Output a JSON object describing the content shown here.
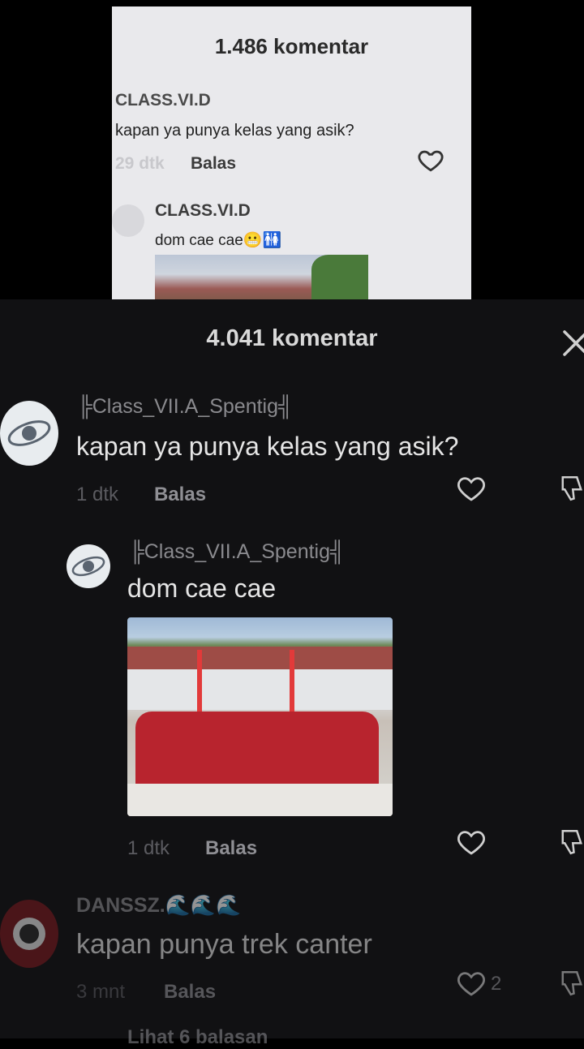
{
  "top_card": {
    "title": "1.486 komentar",
    "comment1": {
      "user": "CLASS.VI.D",
      "text": "kapan ya punya kelas yang asik?",
      "time": "29 dtk",
      "reply": "Balas"
    },
    "comment2": {
      "user": "CLASS.VI.D",
      "text": "dom cae cae😬🚻"
    }
  },
  "sheet": {
    "title": "4.041 komentar",
    "comments": [
      {
        "user": "╠Class_VII.A_Spentig╣",
        "text": "kapan ya punya kelas yang asik?",
        "time": "1 dtk",
        "reply": "Balas"
      },
      {
        "user": "╠Class_VII.A_Spentig╣",
        "text": "dom cae cae",
        "time": "1 dtk",
        "reply": "Balas"
      },
      {
        "user": "DANSSZ.🌊🌊🌊",
        "text": "kapan punya trek canter",
        "time": "3 mnt",
        "reply": "Balas",
        "likes": "2"
      }
    ],
    "view_replies": "Lihat 6 balasan"
  },
  "colors": {
    "background": "#000000",
    "sheet": "#111113",
    "card": "#e9e9ec"
  },
  "icons": [
    "heart-icon",
    "dislike-icon",
    "close-icon"
  ]
}
